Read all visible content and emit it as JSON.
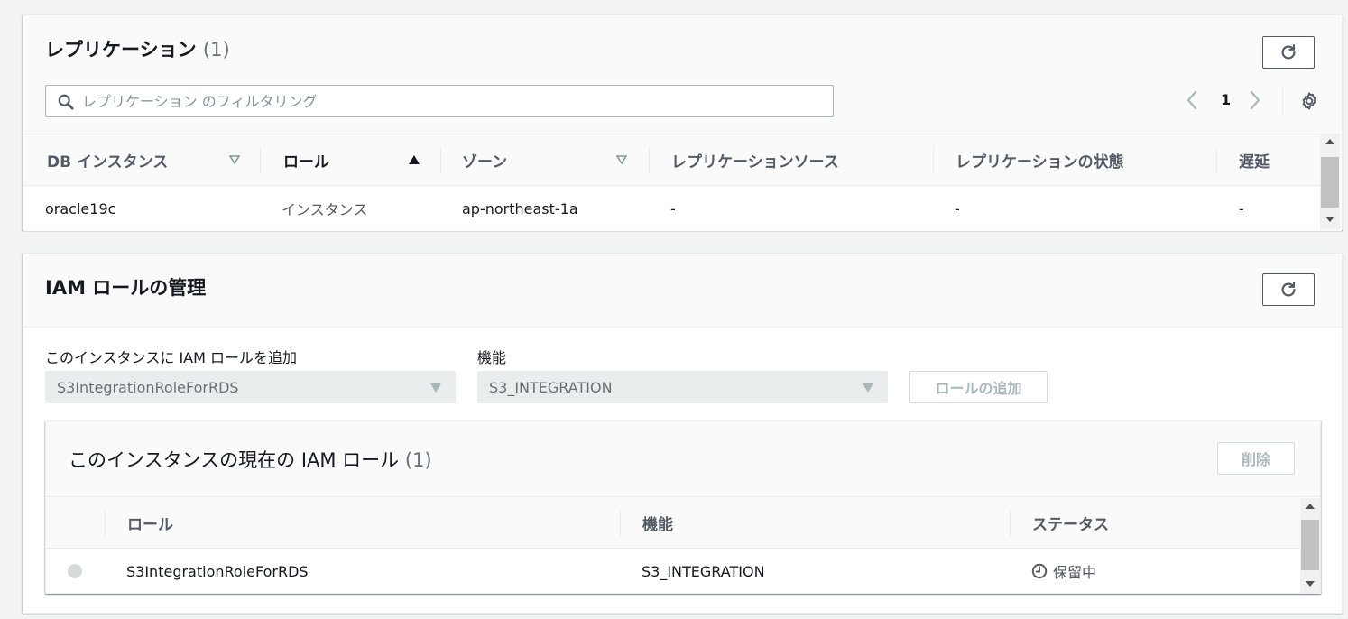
{
  "replication": {
    "title": "レプリケーション",
    "count": "(1)",
    "filter_placeholder": "レプリケーション のフィルタリング",
    "page_number": "1",
    "columns": [
      "DB インスタンス",
      "ロール",
      "ゾーン",
      "レプリケーションソース",
      "レプリケーションの状態",
      "遅延"
    ],
    "rows": [
      {
        "instance": "oracle19c",
        "role": "インスタンス",
        "zone": "ap-northeast-1a",
        "source": "-",
        "state": "-",
        "lag": "-"
      }
    ]
  },
  "iam": {
    "title": "IAM ロールの管理",
    "add_role_label": "このインスタンスに IAM ロールを追加",
    "feature_label": "機能",
    "role_select_value": "S3IntegrationRoleForRDS",
    "feature_select_value": "S3_INTEGRATION",
    "add_button": "ロールの追加",
    "current": {
      "title": "このインスタンスの現在の IAM ロール",
      "count": "(1)",
      "delete_button": "削除",
      "columns": [
        "ロール",
        "機能",
        "ステータス"
      ],
      "rows": [
        {
          "role": "S3IntegrationRoleForRDS",
          "feature": "S3_INTEGRATION",
          "status": "保留中"
        }
      ]
    }
  },
  "colors": {
    "background": "#f2f3f3",
    "border": "#eaeded",
    "text": "#16191f",
    "muted": "#687078",
    "disabled": "#aab7b8"
  }
}
